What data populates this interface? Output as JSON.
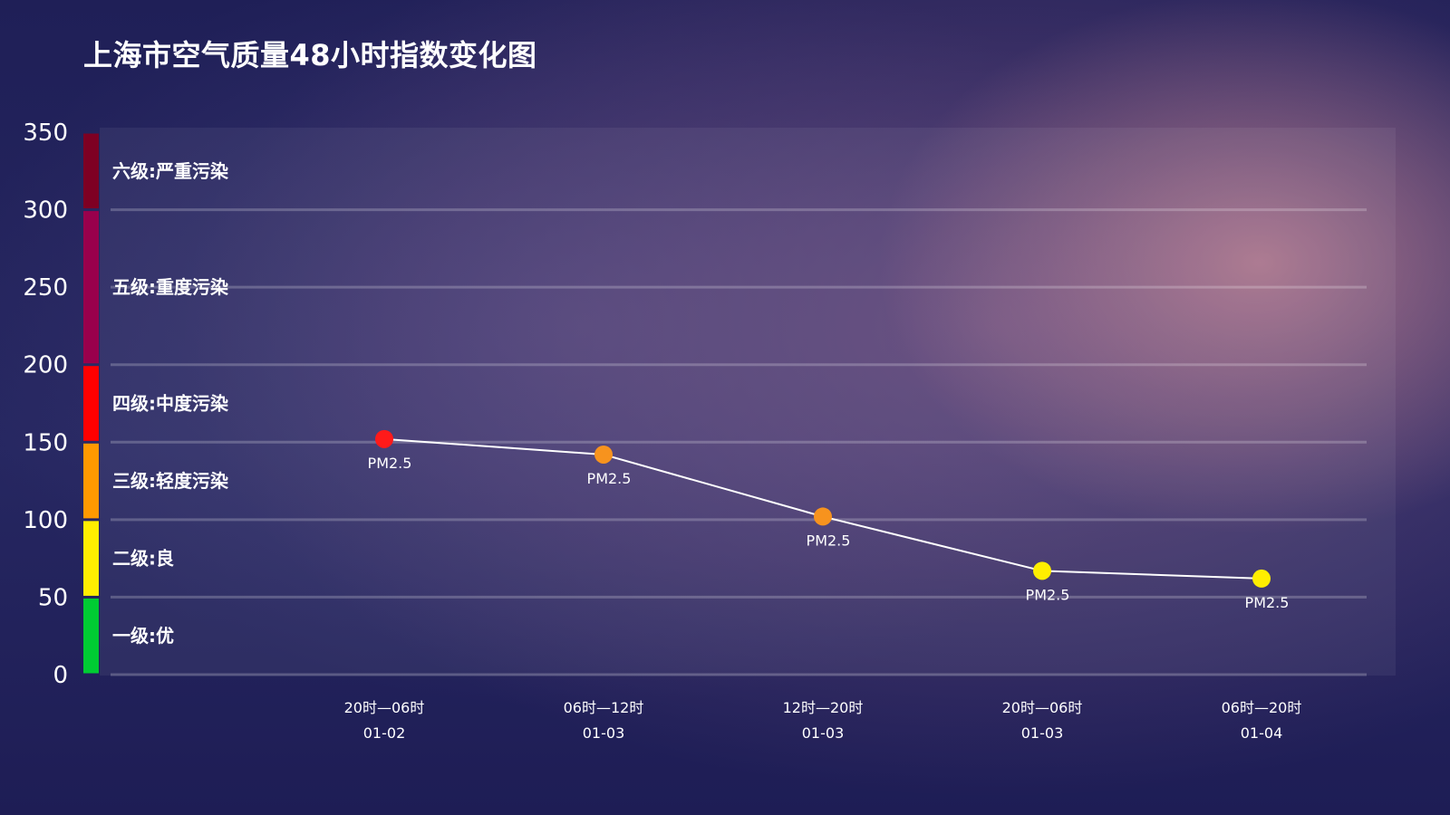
{
  "title": "上海市空气质量48小时指数变化图",
  "chart_data": {
    "type": "line",
    "title": "上海市空气质量48小时指数变化图",
    "ylim": [
      0,
      350
    ],
    "y_ticks": [
      0,
      50,
      100,
      150,
      200,
      250,
      300,
      350
    ],
    "grid": true,
    "categories": [
      {
        "time": "20时—06时",
        "date": "01-02"
      },
      {
        "time": "06时—12时",
        "date": "01-03"
      },
      {
        "time": "12时—20时",
        "date": "01-03"
      },
      {
        "time": "20时—06时",
        "date": "01-03"
      },
      {
        "time": "06时—20时",
        "date": "01-04"
      }
    ],
    "series": [
      {
        "values": [
          152,
          142,
          102,
          67,
          62
        ],
        "point_labels": [
          "PM2.5",
          "PM2.5",
          "PM2.5",
          "PM2.5",
          "PM2.5"
        ],
        "point_colors": [
          "#ff1a1a",
          "#f7931e",
          "#f7931e",
          "#ffee00",
          "#ffee00"
        ],
        "line_color": "#ffffff"
      }
    ],
    "bands": [
      {
        "label": "一级:优",
        "from": 0,
        "to": 50,
        "color": "#00cc33"
      },
      {
        "label": "二级:良",
        "from": 50,
        "to": 100,
        "color": "#ffee00"
      },
      {
        "label": "三级:轻度污染",
        "from": 100,
        "to": 150,
        "color": "#ff9900"
      },
      {
        "label": "四级:中度污染",
        "from": 150,
        "to": 200,
        "color": "#ff0000"
      },
      {
        "label": "五级:重度污染",
        "from": 200,
        "to": 300,
        "color": "#99004c"
      },
      {
        "label": "六级:严重污染",
        "from": 300,
        "to": 350,
        "color": "#7e0023"
      }
    ]
  }
}
